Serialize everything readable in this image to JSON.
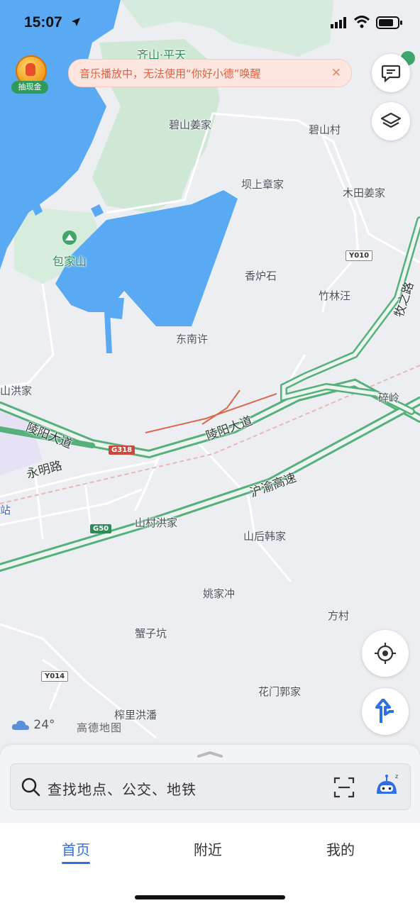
{
  "status_bar": {
    "time": "15:07"
  },
  "map": {
    "labels": {
      "qishan_pingtian": "齐山·平天",
      "bishan_jiangjia": "碧山姜家",
      "bishan_cun": "碧山村",
      "bashang_zhangjia": "坝上章家",
      "mutian_jiangjia": "木田姜家",
      "baojiashan": "包家山",
      "xianglushi": "香炉石",
      "zhulinwang": "竹林汪",
      "dongnanxu": "东南许",
      "shanhongjia": "山洪家",
      "suiling": "碎岭",
      "lingyang_road_w": "陵阳大道",
      "lingyang_road_e": "陵阳大道",
      "yongming_road": "永明路",
      "huyu_expressway": "沪渝高速",
      "muzhi_road": "牧之路",
      "shancun_hongjia": "山村洪家",
      "shanhou_hanjia": "山后韩家",
      "yaojiachong": "姚家冲",
      "fangcun": "方村",
      "xiezikeng": "蟹子坑",
      "huamen_guojia": "花门郭家",
      "zhali_hongpan": "榨里洪潘",
      "zhan": "站"
    },
    "shields": {
      "y010": "Y010",
      "g318": "G318",
      "g50": "G50",
      "y014": "Y014"
    }
  },
  "cashout_badge": {
    "label": "抽现金"
  },
  "notice": {
    "text": "音乐播放中，无法使用“你好小德”唤醒",
    "close": "✕"
  },
  "weather": {
    "temp": "24°"
  },
  "logo_text": "高德地图",
  "search": {
    "placeholder": "查找地点、公交、地铁"
  },
  "tabs": [
    {
      "label": "首页",
      "active": true
    },
    {
      "label": "附近",
      "active": false
    },
    {
      "label": "我的",
      "active": false
    }
  ],
  "colors": {
    "water": "#5aa9f3",
    "green_area": "#cfe8d6",
    "highway": "#56b07c",
    "accent": "#2f6fe4",
    "drawn_line": "#d9694e"
  }
}
